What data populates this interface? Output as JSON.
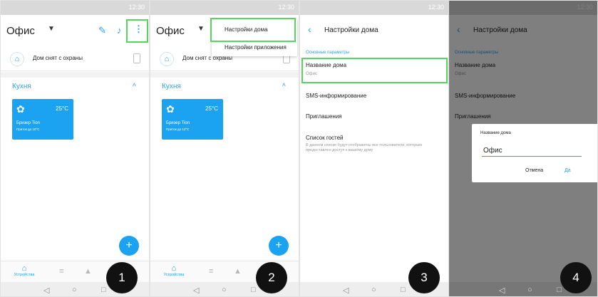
{
  "status": {
    "time": "12:30"
  },
  "screen1": {
    "title": "Офис",
    "guard_text": "Дом снят с охраны",
    "room": "Кухня",
    "device": {
      "name": "Бризер Tion",
      "temp": "25°C",
      "sub": "Приток до 10°C"
    },
    "fab": "+",
    "nav_home": "Устройства",
    "step": "1"
  },
  "screen2": {
    "title": "Офис",
    "guard_text": "Дом снят с охраны",
    "room": "Кухня",
    "device": {
      "name": "Бризер Tion",
      "temp": "25°C",
      "sub": "Приток до 13°C"
    },
    "menu_home_settings": "Настройки дома",
    "menu_app_settings": "Настройки приложения",
    "fab": "+",
    "nav_home": "Устройства",
    "step": "2"
  },
  "screen3": {
    "title": "Настройки дома",
    "section": "Основные параметры",
    "house_name_label": "Название дома",
    "house_name_value": "Офис",
    "sms": "SMS-информирование",
    "invites": "Приглашения",
    "guests": "Список гостей",
    "guests_desc": "В данном списке будут отображены все пользователи, которым предоставлен доступ к вашему дому",
    "step": "3"
  },
  "screen4": {
    "title": "Настройки дома",
    "section": "Основные параметры",
    "house_name_label": "Название дома",
    "house_name_value": "Офис",
    "sms": "SMS-информирование",
    "invites": "Приглашения",
    "dialog_title": "Название дома",
    "dialog_value": "Офис",
    "cancel": "Отмена",
    "ok": "Да",
    "step": "4"
  },
  "colors": {
    "accent": "#1ba2f0",
    "highlight": "#56d65c"
  },
  "icons": [
    "pencil-icon",
    "mic-icon",
    "more-vert-icon",
    "house-icon",
    "lock-icon",
    "fan-icon",
    "home-icon",
    "sliders-icon",
    "bell-icon",
    "back-icon"
  ]
}
